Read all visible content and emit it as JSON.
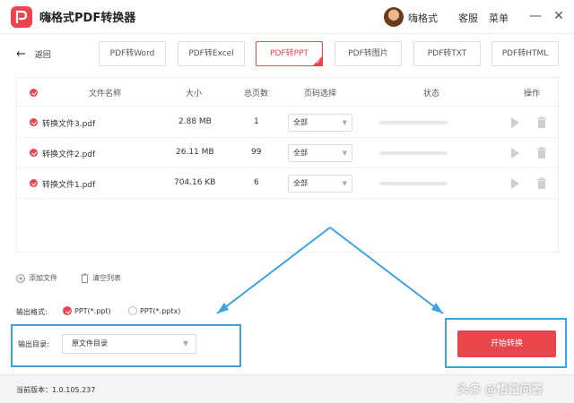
{
  "titlebar": {
    "title": "嗨格式PDF转换器",
    "username": "嗨格式",
    "support": "客服",
    "menu": "菜单",
    "minimize": "—",
    "close": "✕"
  },
  "nav": {
    "back_label": "返回",
    "tabs": [
      "PDF转Word",
      "PDF转Excel",
      "PDF转PPT",
      "PDF转图片",
      "PDF转TXT",
      "PDF转HTML"
    ],
    "active_tab": "PDF转PPT"
  },
  "table": {
    "headers": {
      "name": "文件名称",
      "size": "大小",
      "pages": "总页数",
      "range": "页码选择",
      "status": "状态",
      "actions": "操作"
    },
    "rows": [
      {
        "name": "转换文件3.pdf",
        "size": "2.88 MB",
        "pages": "1",
        "range": "全部",
        "progress": 0
      },
      {
        "name": "转换文件2.pdf",
        "size": "26.11 MB",
        "pages": "99",
        "range": "全部",
        "progress": 0
      },
      {
        "name": "转换文件1.pdf",
        "size": "704.16 KB",
        "pages": "6",
        "range": "全部",
        "progress": 0
      }
    ]
  },
  "actions": {
    "add_file": "添加文件",
    "clear_list": "清空列表"
  },
  "output": {
    "format_label": "输出格式:",
    "formats": [
      "PPT(*.ppt)",
      "PPT(*.pptx)"
    ],
    "selected_format": "PPT(*.ppt)",
    "dir_label": "输出目录:",
    "dir_value": "原文件目录"
  },
  "start_button": "开始转换",
  "footer": {
    "version": "当前版本：1.0.105.237",
    "watermark": "头条 @悟空问答"
  },
  "colors": {
    "accent": "#e9454d",
    "highlight": "#3ba3e1"
  }
}
